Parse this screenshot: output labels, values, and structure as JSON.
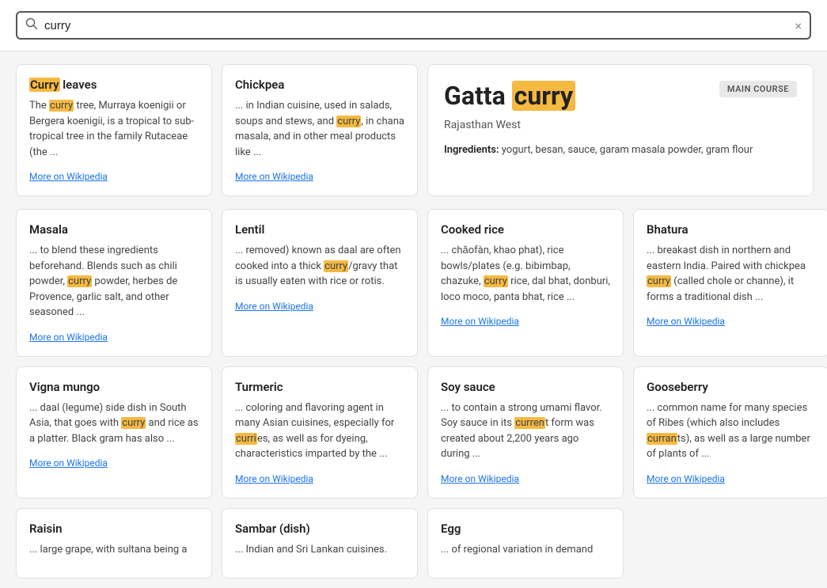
{
  "search": {
    "placeholder": "Search",
    "value": "curry",
    "clear_label": "×"
  },
  "featured": {
    "title_plain": "Gatta",
    "title_highlight": "curry",
    "subtitle": "Rajasthan West",
    "badge": "MAIN COURSE",
    "ingredients_label": "Ingredients:",
    "ingredients_value": "yogurt, besan, sauce, garam masala powder, gram flour"
  },
  "cards_row1": [
    {
      "title_plain": "",
      "title_highlight": "Curry",
      "title_rest": " leaves",
      "body": "The curry tree, Murraya koenigii or Bergera koenigii, is a tropical to sub-tropical tree in the family Rutaceae (the ...",
      "highlight_words": [
        "curry"
      ],
      "wiki_link": "More on Wikipedia"
    },
    {
      "title_plain": "Chickpea",
      "title_highlight": "",
      "title_rest": "",
      "body": "... in Indian cuisine, used in salads, soups and stews, and curry, in chana masala, and in other meal products like ...",
      "highlight_words": [
        "curry"
      ],
      "wiki_link": "More on Wikipedia"
    }
  ],
  "cards_row2": [
    {
      "title": "Masala",
      "body": "... to blend these ingredients beforehand. Blends such as chili powder, curry powder, herbes de Provence, garlic salt, and other seasoned ...",
      "highlight_words": [
        "curry"
      ],
      "wiki_link": "More on Wikipedia"
    },
    {
      "title": "Lentil",
      "body": "... removed) known as daal are often cooked into a thick curry/gravy that is usually eaten with rice or rotis.",
      "highlight_words": [
        "curry"
      ],
      "wiki_link": "More on Wikipedia"
    },
    {
      "title": "Cooked rice",
      "body": "... chǎofàn, khao phat), rice bowls/plates (e.g. bibimbap, chazuke, curry rice, dal bhat, donburi, loco moco, panta bhat, rice ...",
      "highlight_words": [
        "curry"
      ],
      "wiki_link": "More on Wikipedia"
    },
    {
      "title": "Bhatura",
      "body": "... breakast dish in northern and eastern India. Paired with chickpea curry (called chole or channe), it forms a traditional dish ...",
      "highlight_words": [
        "curry"
      ],
      "wiki_link": "More on Wikipedia"
    }
  ],
  "cards_row3": [
    {
      "title": "Vigna mungo",
      "body": "... daal (legume) side dish in South Asia, that goes with curry and rice as a platter. Black gram has also ...",
      "highlight_words": [
        "curry"
      ],
      "wiki_link": "More on Wikipedia"
    },
    {
      "title": "Turmeric",
      "body": "... coloring and flavoring agent in many Asian cuisines, especially for curries, as well as for dyeing, characteristics imparted by the ...",
      "highlight_words": [
        "curri"
      ],
      "wiki_link": "More on Wikipedia"
    },
    {
      "title": "Soy sauce",
      "body": "... to contain a strong umami flavor. Soy sauce in its current form was created about 2,200 years ago during ...",
      "highlight_words": [
        "curren"
      ],
      "wiki_link": "More on Wikipedia"
    },
    {
      "title": "Gooseberry",
      "body": "... common name for many species of Ribes (which also includes currants), as well as a large number of plants of ...",
      "highlight_words": [
        "curran"
      ],
      "wiki_link": "More on Wikipedia"
    }
  ],
  "cards_row4": [
    {
      "title": "Raisin",
      "body": "... large grape, with sultana being a",
      "highlight_words": [],
      "wiki_link": ""
    },
    {
      "title": "Sambar (dish)",
      "body": "... Indian and Sri Lankan cuisines.",
      "highlight_words": [],
      "wiki_link": ""
    },
    {
      "title": "Egg",
      "body": "... of regional variation in demand",
      "highlight_words": [],
      "wiki_link": ""
    }
  ]
}
